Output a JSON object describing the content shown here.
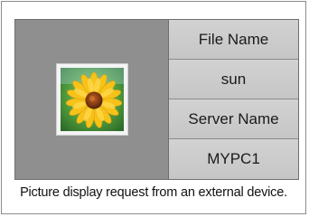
{
  "dialog": {
    "thumbnail_icon": "sunflower-photo-thumbnail",
    "info": {
      "file_name_label": "File Name",
      "file_name_value": "sun",
      "server_name_label": "Server Name",
      "server_name_value": "MYPC1"
    },
    "message": "Picture display request from an external device."
  },
  "colors": {
    "panel_background": "#c4c4c4",
    "thumbnail_area": "#8f8f8f",
    "border": "#6e6e6e",
    "dialog_background": "#ffffff"
  }
}
